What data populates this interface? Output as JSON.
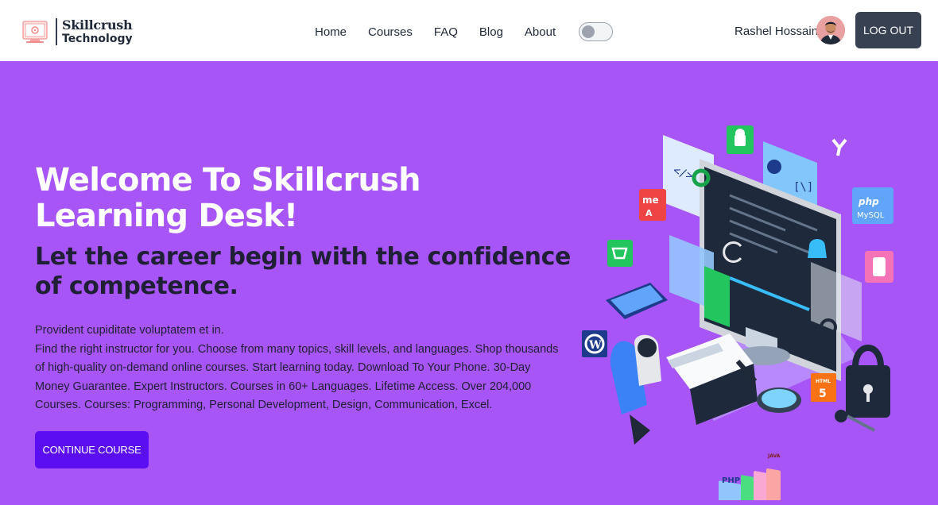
{
  "brand": {
    "line1": "Skillcrush",
    "line2": "Technology"
  },
  "nav": {
    "links": [
      "Home",
      "Courses",
      "FAQ",
      "Blog",
      "About"
    ],
    "theme_toggle": "off"
  },
  "user": {
    "name": "Rashel Hossain",
    "logout_label": "LOG OUT"
  },
  "hero": {
    "title_line1": "Welcome To Skillcrush",
    "title_line2": "Learning Desk!",
    "subtitle": "Let the career begin with the confidence of competence.",
    "body_line1": "Provident cupiditate voluptatem et in.",
    "body_line2": "Find the right instructor for you. Choose from many topics, skill levels, and languages. Shop thousands of high-quality on-demand online courses. Start learning today. Download To Your Phone. 30-Day Money Guarantee. Expert Instructors. Courses in 60+ Languages. Lifetime Access. Over 204,000 Courses. Courses: Programming, Personal Development, Design, Communication, Excel.",
    "cta_label": "CONTINUE COURSE"
  },
  "illustration": {
    "badges": {
      "php_mysql_1": "php",
      "php_mysql_2": "MySQL",
      "html": "HTML",
      "php_book": "PHP",
      "java_book": "JAVA",
      "me": "me"
    }
  },
  "colors": {
    "hero_bg": "#a855f7",
    "cta": "#5b0ef2",
    "logout": "#374151"
  }
}
